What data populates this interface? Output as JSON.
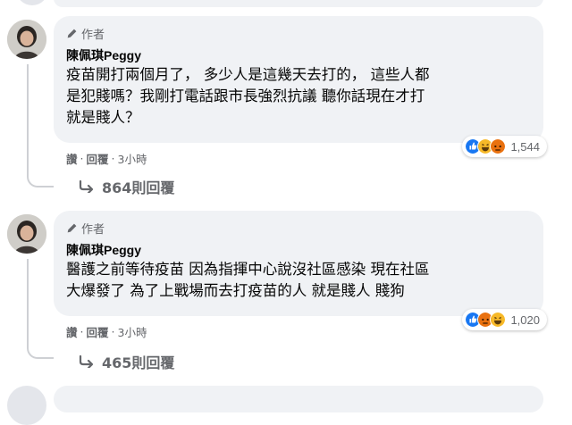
{
  "comments": [
    {
      "author_tag": "作者",
      "name": "陳佩琪Peggy",
      "text": "疫苗開打兩個月了， 多少人是這幾天去打的， 這些人都\n是犯賤嗎？我剛打電話跟市長強烈抗議 聽你話現在才打\n就是賤人？",
      "reaction_count": "1,544",
      "reactions": [
        "like",
        "haha",
        "angry"
      ],
      "action_like": "讚",
      "action_reply": "回覆",
      "timestamp": "3小時",
      "replies_label": "864則回覆"
    },
    {
      "author_tag": "作者",
      "name": "陳佩琪Peggy",
      "text": "醫護之前等待疫苗 因為指揮中心說沒社區感染 現在社區\n大爆發了 為了上戰場而去打疫苗的人 就是賤人 賤狗",
      "reaction_count": "1,020",
      "reactions": [
        "like",
        "angry",
        "haha"
      ],
      "action_like": "讚",
      "action_reply": "回覆",
      "timestamp": "3小時",
      "replies_label": "465則回覆"
    }
  ],
  "separator": "·",
  "colors": {
    "bubble": "#f0f2f5",
    "secondary_text": "#65676b",
    "like_blue": "#1877f2",
    "haha_yellow": "#f7b928",
    "angry_red": "#e9710f"
  }
}
